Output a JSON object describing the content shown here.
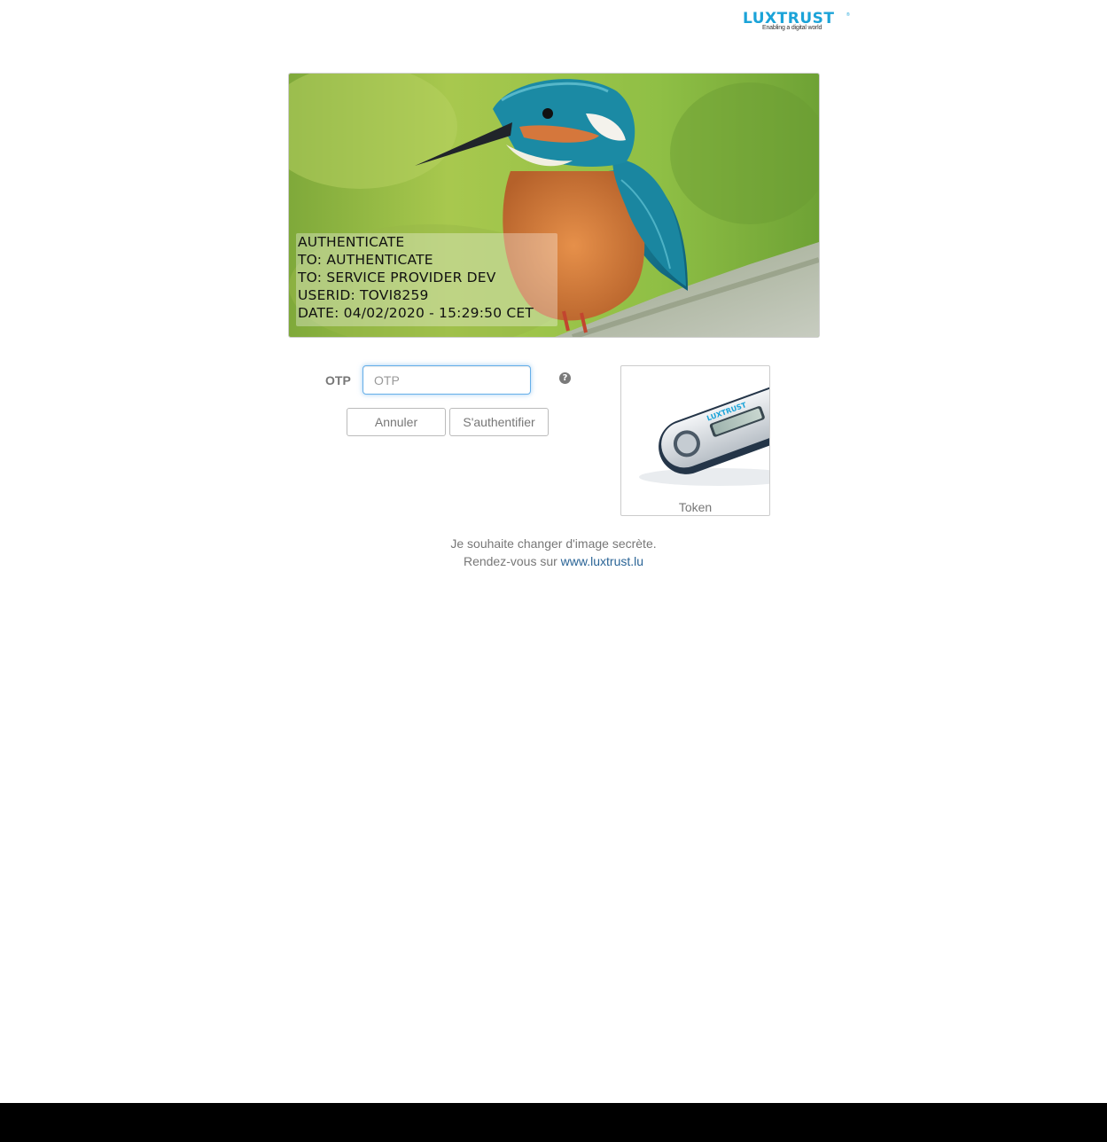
{
  "header": {
    "logo_text": "LUXTRUST",
    "logo_registered": "®",
    "logo_tagline": "Enabling a digital world"
  },
  "secret_image": {
    "subject": "kingfisher-bird",
    "caption_lines": [
      "AUTHENTICATE",
      "TO: AUTHENTICATE",
      "TO: SERVICE PROVIDER DEV",
      "USERID: TOVI8259",
      "DATE: 04/02/2020 - 15:29:50 CET"
    ]
  },
  "form": {
    "otp_label": "OTP",
    "otp_placeholder": "OTP",
    "otp_value": "",
    "help_icon": "question-circle-icon",
    "help_glyph": "?",
    "cancel_label": "Annuler",
    "submit_label": "S'authentifier"
  },
  "token": {
    "label": "Token",
    "device_brand": "LUXTRUST"
  },
  "info": {
    "line1": "Je souhaite changer d'image secrète.",
    "line2_prefix": "Rendez-vous sur ",
    "link_text": "www.luxtrust.lu"
  },
  "colors": {
    "brand": "#1ba3d8",
    "link": "#2a6496",
    "focus": "#66afe9",
    "bottom_bar": "#000000"
  }
}
